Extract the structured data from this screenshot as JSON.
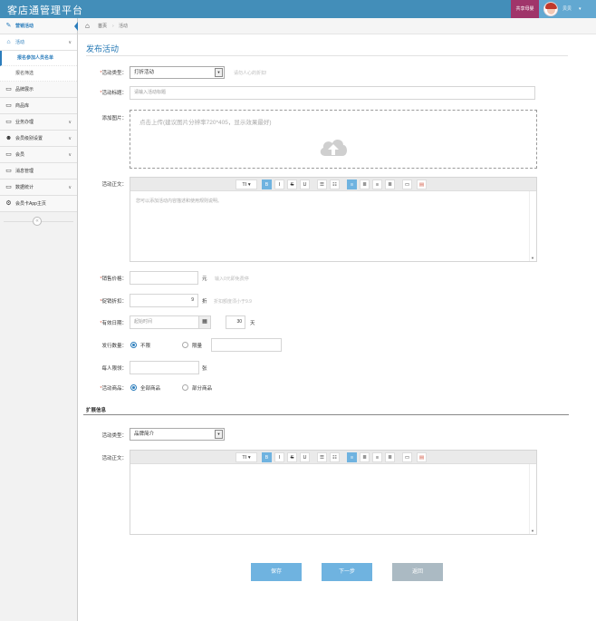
{
  "header": {
    "brand": "客店通管理平台",
    "badge": "共享母婴",
    "user_name": "贝贝",
    "user_caret": "▾"
  },
  "sidebar": {
    "items": [
      {
        "label": "营销活动",
        "icon": "comments-icon",
        "arrow": ""
      },
      {
        "label": "活动",
        "icon": "home-icon",
        "arrow": "∨"
      },
      {
        "label": "品牌展示",
        "icon": "desktop-icon",
        "arrow": ""
      },
      {
        "label": "商品库",
        "icon": "desktop-icon",
        "arrow": ""
      },
      {
        "label": "业务办理",
        "icon": "desktop-icon",
        "arrow": "∨"
      },
      {
        "label": "会员级别设置",
        "icon": "users-icon",
        "arrow": "∨"
      },
      {
        "label": "会员",
        "icon": "desktop-icon",
        "arrow": "∨"
      },
      {
        "label": "消息管理",
        "icon": "desktop-icon",
        "arrow": ""
      },
      {
        "label": "数据统计",
        "icon": "desktop-icon",
        "arrow": "∨"
      },
      {
        "label": "会员卡App主页",
        "icon": "gear-icon",
        "arrow": ""
      }
    ],
    "sub_items": [
      {
        "label": "报名参加人员名单"
      },
      {
        "label": "报名筛选"
      }
    ],
    "collapse_icon": "«"
  },
  "breadcrumb": {
    "home": "首页",
    "separator": "›",
    "current": "活动"
  },
  "page": {
    "title": "发布活动"
  },
  "form": {
    "activity_type": {
      "label": "活动类型：",
      "value": "打折活动",
      "hint": "请勿人心的折扣!"
    },
    "activity_title": {
      "label": "活动标题：",
      "placeholder": "请输入活动标题"
    },
    "add_image": {
      "label": "添加图片：",
      "text": "点击上传(建议图片分辨率720*405，显示效果最好)"
    },
    "content": {
      "label": "活动正文：",
      "placeholder": "您可以添加活动内容描述和使用规则说明。"
    },
    "sale_price": {
      "label": "销售价格：",
      "unit": "元",
      "hint": "输入0元即免费停",
      "value": ""
    },
    "discount": {
      "label": "促销折扣：",
      "value": "9",
      "unit": "折",
      "hint": "折扣额度须小于9.9"
    },
    "valid_date": {
      "label": "有效日期：",
      "placeholder": "起始时间",
      "days": "30",
      "days_unit": "天"
    },
    "issue_count": {
      "label": "发行数量：",
      "opt1": "不限",
      "opt2": "限量"
    },
    "per_person": {
      "label": "每人限领：",
      "unit": "张"
    },
    "goods": {
      "label": "活动商品：",
      "opt1": "全部商品",
      "opt2": "部分商品"
    }
  },
  "extended": {
    "section_title": "扩展信息",
    "activity_type": {
      "label": "活动类型：",
      "value": "品牌简介"
    },
    "content": {
      "label": "活动正文："
    }
  },
  "toolbar": {
    "font": "TI",
    "font_caret": "▾",
    "bold": "B",
    "italic": "I",
    "strike": "S",
    "underline": "U",
    "ol": "☰",
    "ul": "☷",
    "left": "≡",
    "center": "≣",
    "right": "≡",
    "justify": "≣",
    "image": "▭",
    "color": "▤"
  },
  "buttons": {
    "save": "保存",
    "next": "下一步",
    "back": "返回"
  }
}
